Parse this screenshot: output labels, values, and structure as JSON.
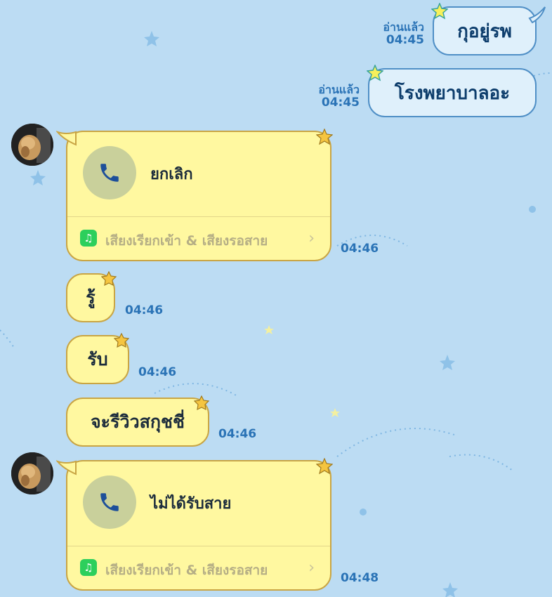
{
  "colors": {
    "background": "#bcdcf3",
    "outgoing_bubble": "#dff0fb",
    "outgoing_border": "#4f8fc6",
    "incoming_bubble": "#fff8a0",
    "incoming_border": "#c9a544",
    "timestamp": "#2a73b6",
    "music_badge": "#2ccf5c"
  },
  "messages": {
    "m1": {
      "text": "กุอยู่รพ",
      "read": "อ่านแล้ว",
      "time": "04:45"
    },
    "m2": {
      "text": "โรงพยาบาลอะ",
      "read": "อ่านแล้ว",
      "time": "04:45"
    },
    "call1": {
      "label": "ยกเลิก",
      "footer": "เสียงเรียกเข้า & เสียงรอสาย",
      "time": "04:46",
      "icon": "phone-icon"
    },
    "m3": {
      "text": "รู้",
      "time": "04:46"
    },
    "m4": {
      "text": "รับ",
      "time": "04:46"
    },
    "m5": {
      "text": "จะรีวิวสกุชชี่",
      "time": "04:46"
    },
    "call2": {
      "label": "ไม่ได้รับสาย",
      "footer": "เสียงเรียกเข้า & เสียงรอสาย",
      "time": "04:48",
      "icon": "phone-icon"
    }
  }
}
